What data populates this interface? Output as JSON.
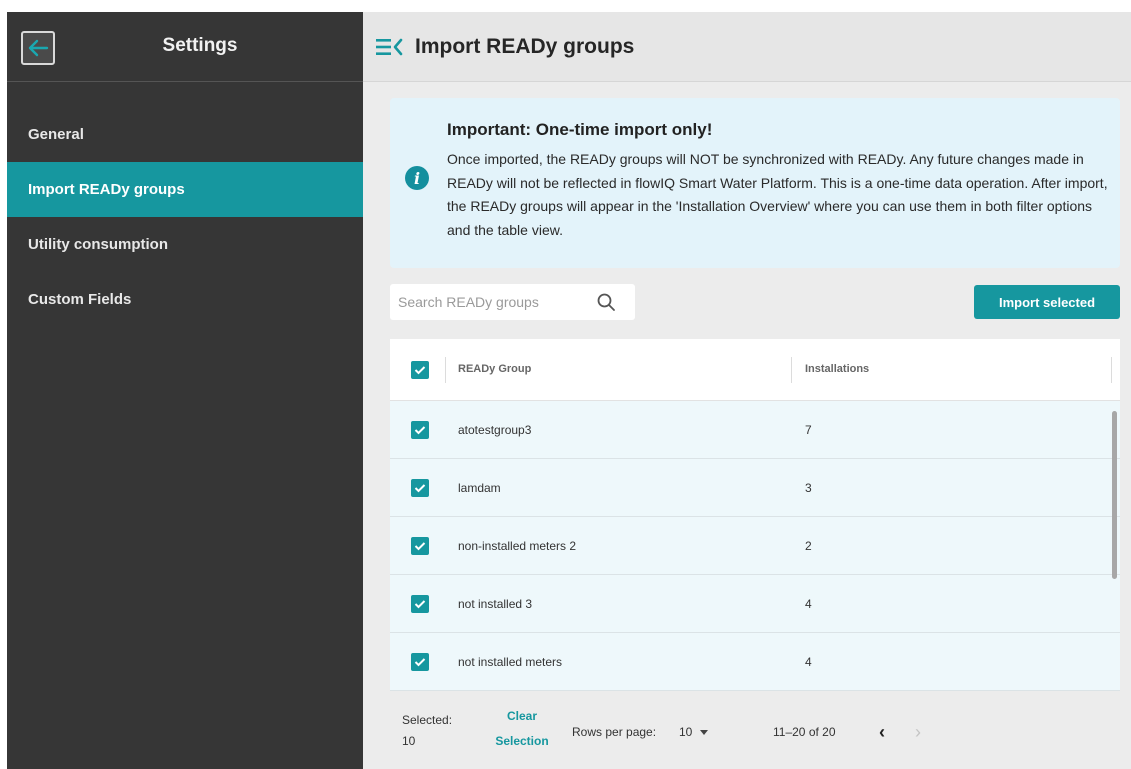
{
  "sidebar": {
    "title": "Settings",
    "back_icon": "arrow-left-icon",
    "items": [
      {
        "label": "General"
      },
      {
        "label": "Import READy groups"
      },
      {
        "label": "Utility consumption"
      },
      {
        "label": "Custom Fields"
      }
    ],
    "active_index": 1
  },
  "header": {
    "title": "Import READy groups",
    "menu_icon": "menu-collapse-icon"
  },
  "banner": {
    "icon": "info-icon",
    "title": "Important: One-time import only!",
    "text": "Once imported, the READy groups will NOT be synchronized with READy. Any future changes made in READy will not be reflected in flowIQ Smart Water Platform. This is a one-time data operation. After import, the READy groups will appear in the 'Installation Overview' where you can use them in both filter options and the table view."
  },
  "search": {
    "placeholder": "Search READy groups",
    "value": ""
  },
  "import_button": "Import selected",
  "table": {
    "columns": [
      "READy Group",
      "Installations"
    ],
    "rows": [
      {
        "group": "atotestgroup3",
        "installations": "7",
        "checked": true
      },
      {
        "group": "lamdam",
        "installations": "3",
        "checked": true
      },
      {
        "group": "non-installed meters 2",
        "installations": "2",
        "checked": true
      },
      {
        "group": "not installed 3",
        "installations": "4",
        "checked": true
      },
      {
        "group": "not installed meters",
        "installations": "4",
        "checked": true
      }
    ]
  },
  "footer": {
    "selected_label": "Selected:",
    "selected_count": "10",
    "clear_label": "Clear Selection",
    "rows_per_page_label": "Rows per page:",
    "rows_per_page_value": "10",
    "range": "11–20 of 20",
    "prev": "‹",
    "next": "›"
  },
  "colors": {
    "accent": "#16979f",
    "sidebar_bg": "#363636",
    "banner_bg": "#e3f3fa"
  }
}
